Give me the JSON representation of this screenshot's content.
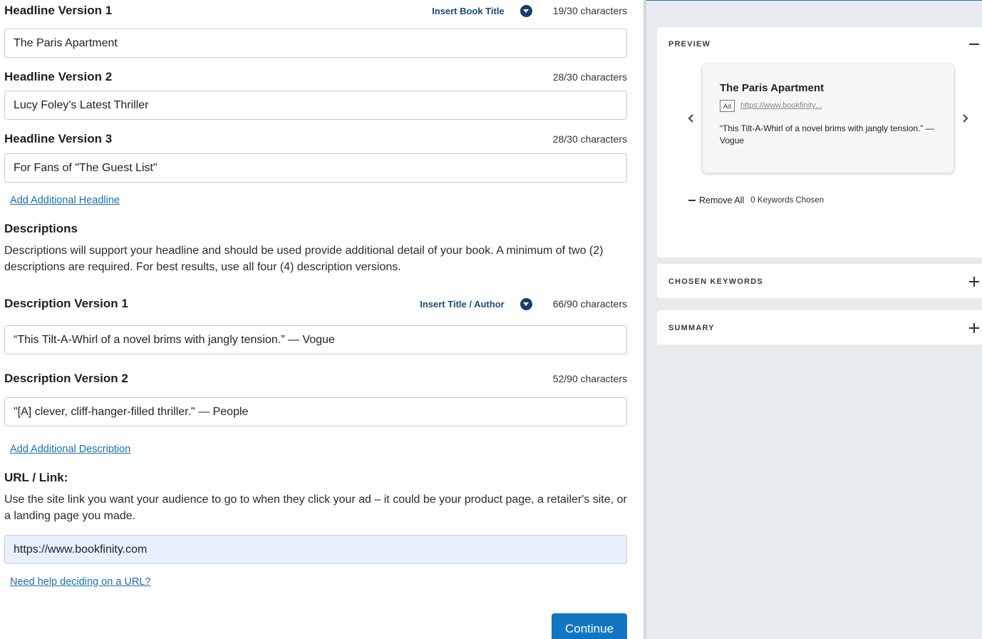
{
  "form": {
    "headline1": {
      "label": "Headline Version 1",
      "insert_label": "Insert Book Title",
      "count": "19/30 characters",
      "value": "The Paris Apartment"
    },
    "headline2": {
      "label": "Headline Version 2",
      "count": "28/30 characters",
      "value": "Lucy Foley's Latest Thriller"
    },
    "headline3": {
      "label": "Headline Version 3",
      "count": "28/30 characters",
      "value": "For Fans of \"The Guest List\""
    },
    "add_headline": "Add Additional Headline",
    "descriptions_title": "Descriptions",
    "descriptions_text": "Descriptions will support your headline and should be used provide additional detail of your book. A minimum of two (2) descriptions are required. For best results, use all four (4) description versions.",
    "desc1": {
      "label": "Description Version 1",
      "insert_label": "Insert Title / Author",
      "count": "66/90 characters",
      "value": "“This Tilt-A-Whirl of a novel brims with jangly tension.”  — Vogue"
    },
    "desc2": {
      "label": "Description Version 2",
      "count": "52/90 characters",
      "value": "\"[A] clever, cliff-hanger-filled thriller.\" — People"
    },
    "add_description": "Add Additional Description",
    "url_title": "URL / Link:",
    "url_text": "Use the site link you want your audience to go to when they click your ad – it could be your product page, a retailer's site, or a landing page you made.",
    "url_value": "https://www.bookfinity.com",
    "url_help": "Need help deciding on a URL?",
    "continue_label": "Continue"
  },
  "sidebar": {
    "preview": {
      "title": "PREVIEW",
      "ad_title": "The Paris Apartment",
      "ad_badge": "Ad",
      "ad_url": "https://www.bookfinity...",
      "ad_desc": "“This Tilt-A-Whirl of a novel brims with jangly tension.” — Vogue",
      "remove_all": "Remove All",
      "keywords_count": "0 Keywords Chosen"
    },
    "chosen_keywords": {
      "title": "CHOSEN KEYWORDS"
    },
    "summary": {
      "title": "SUMMARY"
    }
  },
  "colors": {
    "accent": "#1275c2",
    "link": "#1a6fb0",
    "dark_navy": "#16406b",
    "panel_bg": "#e8ebee",
    "url_input_bg": "#e8f0fe"
  },
  "icons": {
    "insert_dropdown": "chevron-down-icon",
    "collapse": "minus-icon",
    "expand": "plus-icon",
    "prev": "chevron-left-icon",
    "next": "chevron-right-icon",
    "remove": "dash-icon"
  }
}
